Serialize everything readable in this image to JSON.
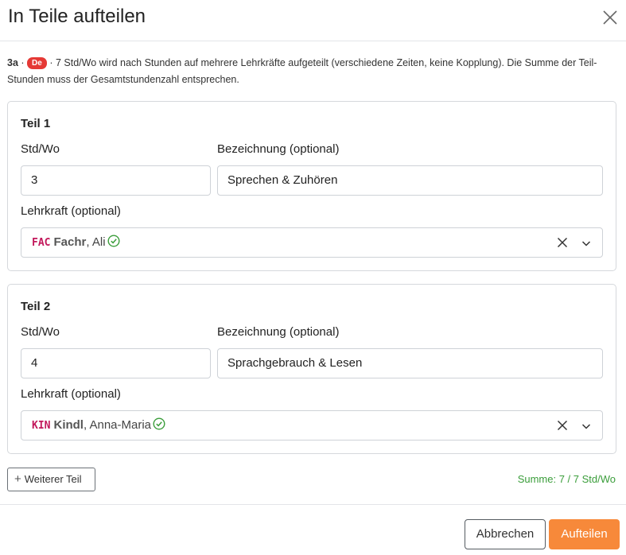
{
  "dialog": {
    "title": "In Teile aufteilen",
    "close_icon": "close-icon"
  },
  "intro": {
    "class_name": "3a",
    "subject_badge": "De",
    "subject_badge_color": "#e53935",
    "text": "· 7 Std/Wo wird nach Stunden auf mehrere Lehrkräfte aufgeteilt (verschiedene Zeiten, keine Kopplung). Die Summe der Teil-Stunden muss der Gesamtstundenzahl entsprechen."
  },
  "labels": {
    "hours": "Std/Wo",
    "designation": "Bezeichnung (optional)",
    "teacher": "Lehrkraft (optional)"
  },
  "parts": [
    {
      "title": "Teil 1",
      "hours": "3",
      "designation": "Sprechen & Zuhören",
      "teacher_code": "FAC",
      "teacher_last": "Fachr",
      "teacher_first": ", Ali"
    },
    {
      "title": "Teil 2",
      "hours": "4",
      "designation": "Sprachgebrauch & Lesen",
      "teacher_code": "KIN",
      "teacher_last": "Kindl",
      "teacher_first": ", Anna-Maria"
    }
  ],
  "actions": {
    "add_part": "Weiterer Teil",
    "sum": "Summe: 7 / 7 Std/Wo",
    "cancel": "Abbrechen",
    "confirm": "Aufteilen"
  },
  "colors": {
    "accent": "#f7893a",
    "success": "#3a9d3a",
    "teacher_code": "#c2185b"
  }
}
